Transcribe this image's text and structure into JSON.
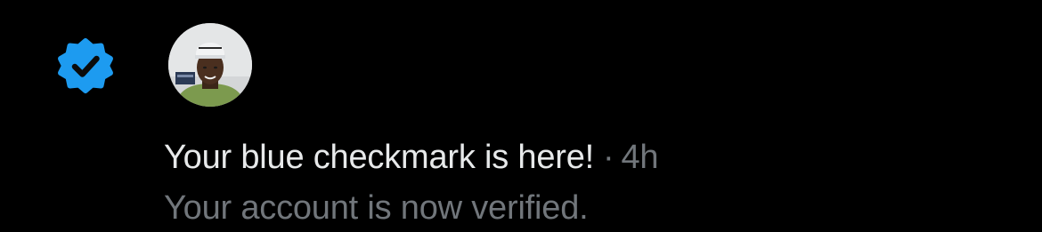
{
  "notification": {
    "icon": "verified-badge-icon",
    "avatar": "user-avatar",
    "title": "Your blue checkmark is here!",
    "separator": "·",
    "timestamp": "4h",
    "body": "Your account is now verified."
  },
  "colors": {
    "background": "#000000",
    "badge_blue": "#1d9bf0",
    "title_text": "#e7e9ea",
    "secondary_text": "#71767b"
  }
}
